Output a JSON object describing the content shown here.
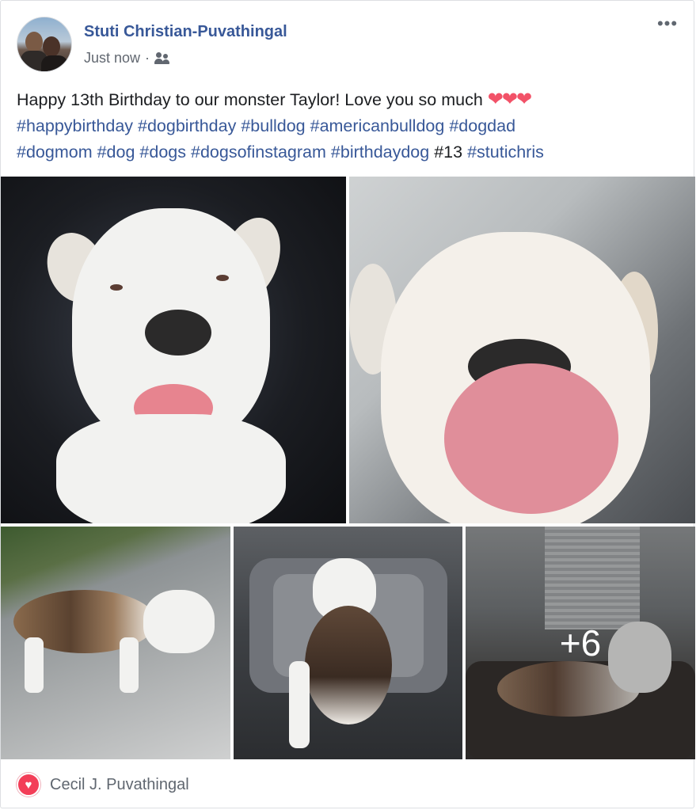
{
  "post": {
    "author": "Stuti Christian-Puvathingal",
    "timestamp": "Just now",
    "separator": "·",
    "audience_icon": "friends-icon",
    "more_label": "•••",
    "message_text": "Happy 13th Birthday to our monster Taylor! Love you so much",
    "hearts": "❤❤❤",
    "hashtags": [
      "#happybirthday",
      "#dogbirthday",
      "#bulldog",
      "#americanbulldog",
      "#dogdad",
      "#dogmom",
      "#dog",
      "#dogs",
      "#dogsofinstagram",
      "#birthdaydog"
    ],
    "plain_tag": "#13",
    "last_hashtag": "#stutichris"
  },
  "photos": {
    "more_count": "+6"
  },
  "reactions": {
    "icon": "love-reaction-icon",
    "glyph": "♥",
    "reactor": "Cecil J. Puvathingal"
  },
  "colors": {
    "link": "#385898",
    "love": "#f33e58"
  }
}
